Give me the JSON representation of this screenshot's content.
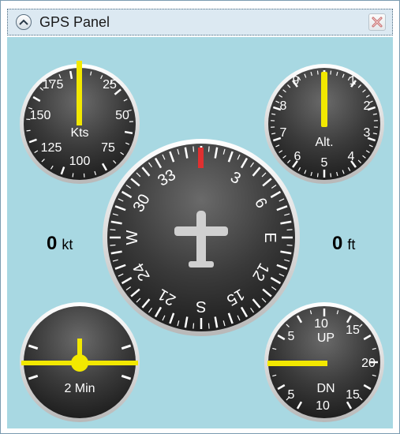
{
  "window": {
    "title": "GPS Panel"
  },
  "icons": {
    "collapse": "chevron-up-icon",
    "close": "close-icon"
  },
  "colors": {
    "background": "#a8d8e2",
    "needle": "#f2e800",
    "heading_marker": "#e03030",
    "aircraft": "#d0d0d0"
  },
  "speed_gauge": {
    "unit_label": "Kts",
    "ticks": [
      "175",
      "25",
      "150",
      "50",
      "125",
      "75",
      "100"
    ],
    "needle_value": 0
  },
  "altitude_gauge": {
    "unit_label": "Alt.",
    "ticks": [
      "9",
      "1",
      "8",
      "2",
      "7",
      "3",
      "6",
      "4",
      "5"
    ],
    "needle_value": 0
  },
  "heading_gauge": {
    "labels": [
      "33",
      "3",
      "6",
      "E",
      "12",
      "15",
      "S",
      "21",
      "24",
      "W",
      "30"
    ],
    "heading": 0
  },
  "turn_gauge": {
    "label": "2 Min"
  },
  "vsi_gauge": {
    "up_label": "UP",
    "down_label": "DN",
    "ticks": [
      "10",
      "15",
      "5",
      "20",
      "5",
      "15",
      "10"
    ],
    "needle_value": 0
  },
  "readouts": {
    "speed": {
      "value": "0",
      "unit": "kt"
    },
    "altitude": {
      "value": "0",
      "unit": "ft"
    }
  }
}
